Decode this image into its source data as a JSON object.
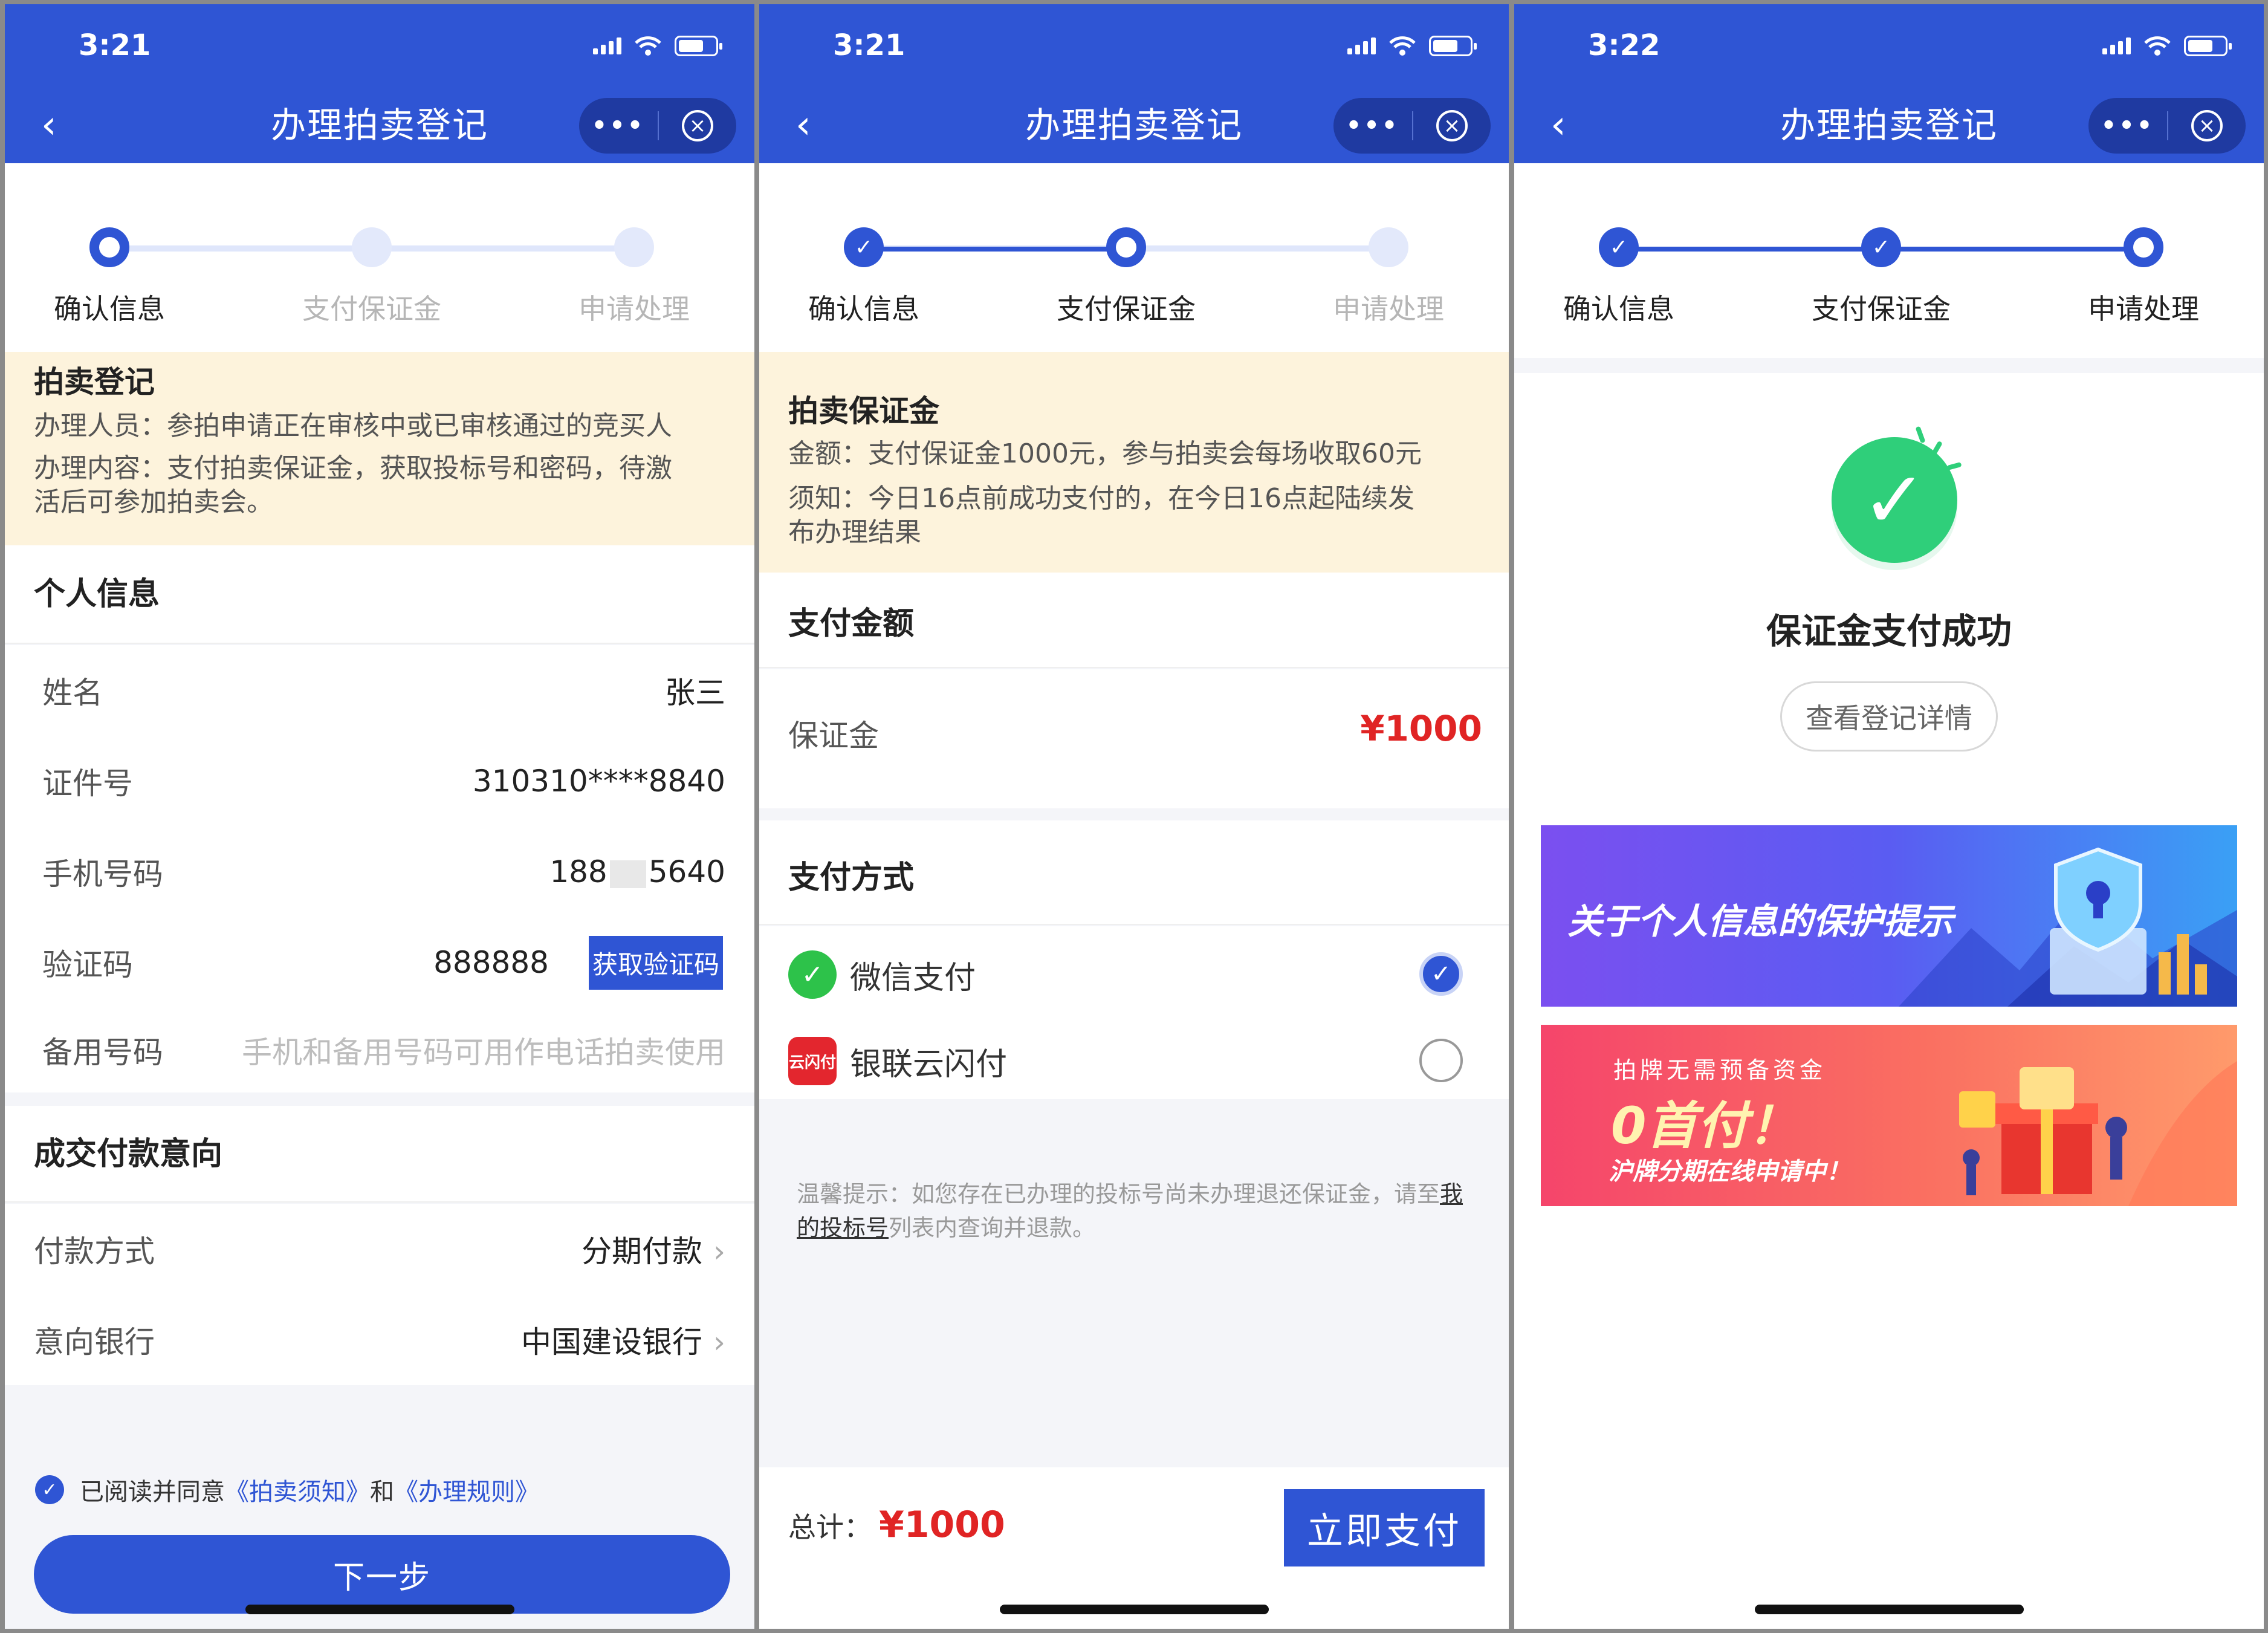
{
  "common": {
    "nav_title": "办理拍卖登记",
    "back_glyph": "‹",
    "more_glyph": "•••",
    "close_glyph": "×",
    "steps": [
      "确认信息",
      "支付保证金",
      "申请处理"
    ],
    "done_glyph": "✓"
  },
  "screen1": {
    "time": "3:21",
    "notice": {
      "title": "拍卖登记",
      "lines": [
        "办理人员：参拍申请正在审核中或已审核通过的竞买人",
        "办理内容：支付拍卖保证金，获取投标号和密码，待激",
        "活后可参加拍卖会。"
      ]
    },
    "personal": {
      "title": "个人信息",
      "name_label": "姓名",
      "name_value": "张三",
      "id_label": "证件号",
      "id_value": "310310****8840",
      "phone_label": "手机号码",
      "phone_prefix": "188",
      "phone_suffix": "5640",
      "code_label": "验证码",
      "code_value": "888888",
      "code_button": "获取验证码",
      "backup_label": "备用号码",
      "backup_placeholder": "手机和备用号码可用作电话拍卖使用"
    },
    "payment": {
      "title": "成交付款意向",
      "method_label": "付款方式",
      "method_value": "分期付款",
      "bank_label": "意向银行",
      "bank_value": "中国建设银行",
      "chevron": "›"
    },
    "agree": {
      "prefix": "已阅读并同意",
      "link1": "《拍卖须知》",
      "and": "和",
      "link2": "《办理规则》"
    },
    "next_button": "下一步"
  },
  "screen2": {
    "time": "3:21",
    "notice": {
      "title": "拍卖保证金",
      "lines": [
        "金额：支付保证金1000元，参与拍卖会每场收取60元",
        "须知：今日16点前成功支付的，在今日16点起陆续发",
        "布办理结果"
      ]
    },
    "amount_title": "支付金额",
    "deposit_label": "保证金",
    "deposit_value": "¥1000",
    "method_title": "支付方式",
    "wechat": "微信支付",
    "unionpay": "银联云闪付",
    "unionpay_icon_text": "云闪付",
    "tip_before": "温馨提示：如您存在已办理的投标号尚未办理退还保证金，请至",
    "tip_link": "我的投标号",
    "tip_after": "列表内查询并退款。",
    "total_label": "总计：",
    "total_value": "¥1000",
    "pay_button": "立即支付"
  },
  "screen3": {
    "time": "3:22",
    "success_title": "保证金支付成功",
    "detail_button": "查看登记详情",
    "banner1_text": "关于个人信息的保护提示",
    "banner2_line1": "拍牌无需预备资金",
    "banner2_line2": "0首付！",
    "banner2_line3": "沪牌分期在线申请中！"
  },
  "colors": {
    "primary": "#2f55d4",
    "price_red": "#e02424",
    "notice_bg": "#fdf3dc",
    "success_green": "#2fcf7a"
  },
  "icons": [
    "back-arrow-icon",
    "more-icon",
    "close-circle-icon",
    "signal-icon",
    "wifi-icon",
    "battery-icon",
    "check-icon",
    "wechat-pay-icon",
    "unionpay-icon",
    "chevron-right-icon",
    "success-check-icon"
  ]
}
